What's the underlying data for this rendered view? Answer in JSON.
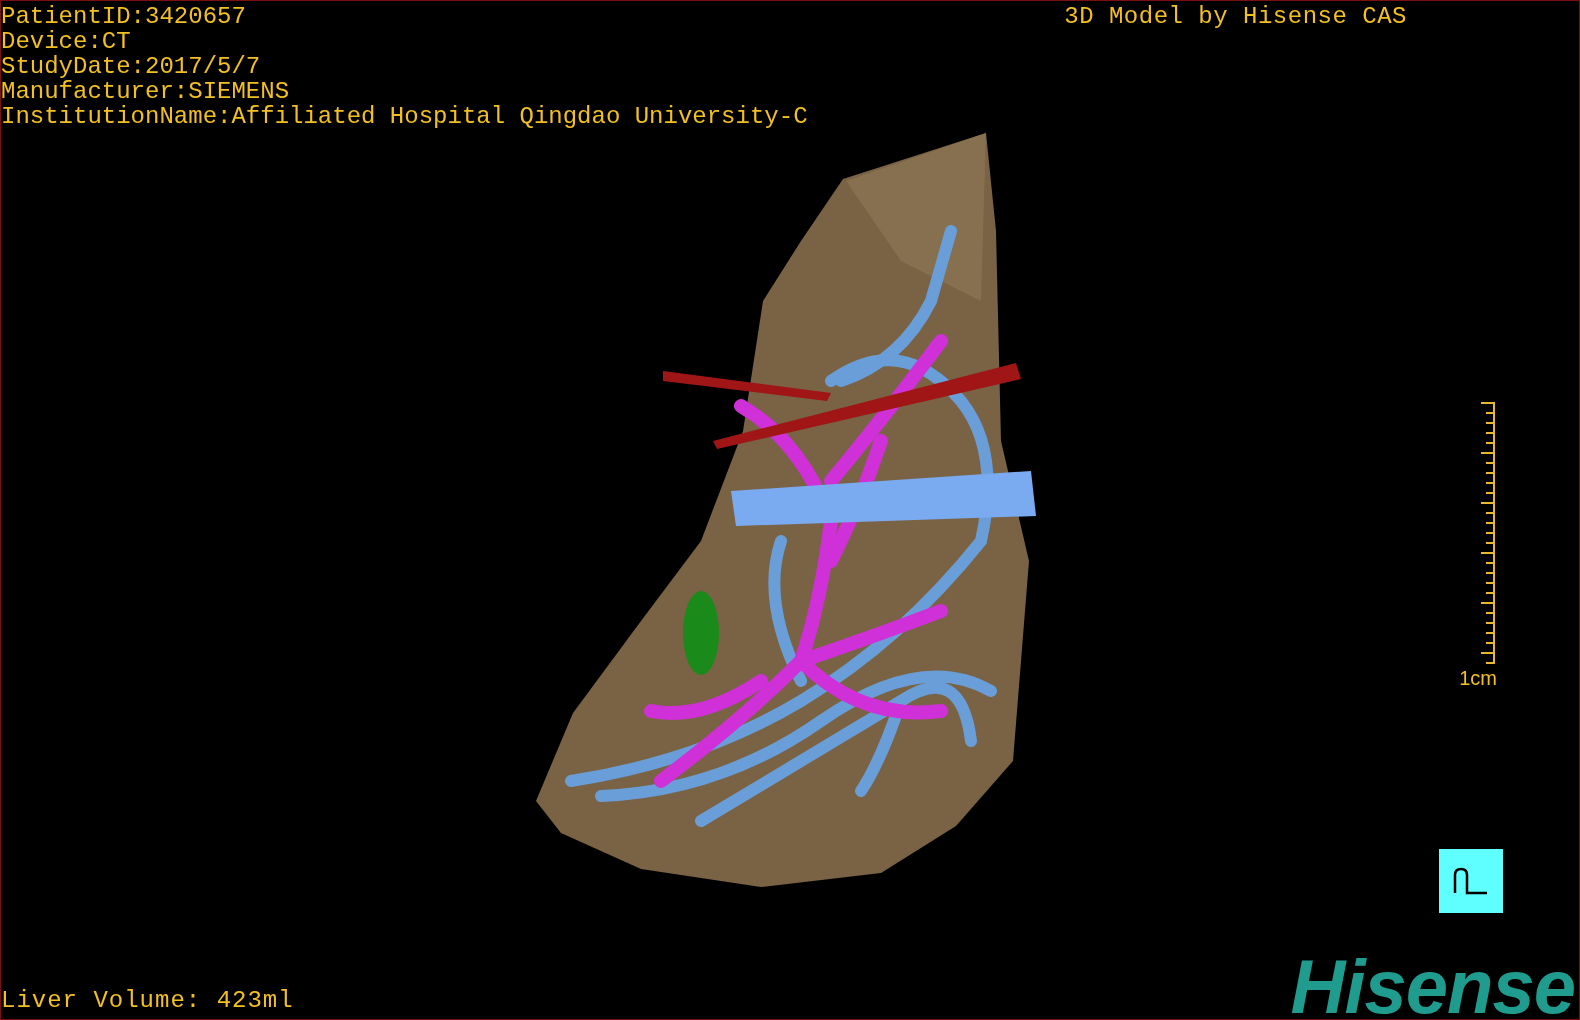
{
  "info_lines": [
    "PatientID:3420657",
    "Device:CT",
    "StudyDate:2017/5/7",
    "Manufacturer:SIEMENS",
    "InstitutionName:Affiliated Hospital Qingdao University-C"
  ],
  "model_title": "3D Model by Hisense CAS",
  "scale_bar": {
    "label": "1cm"
  },
  "liver_volume": "Liver Volume: 423ml",
  "logo": "Hisense"
}
